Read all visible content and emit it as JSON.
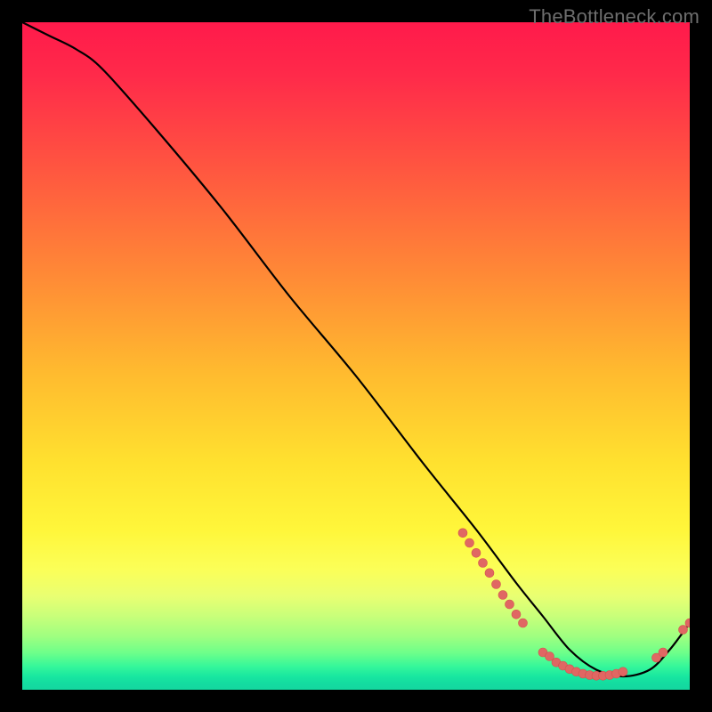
{
  "watermark": "TheBottleneck.com",
  "chart_data": {
    "type": "line",
    "title": "",
    "xlabel": "",
    "ylabel": "",
    "xlim": [
      0,
      100
    ],
    "ylim": [
      0,
      100
    ],
    "series": [
      {
        "name": "curve",
        "x": [
          0,
          4,
          8,
          12,
          20,
          30,
          40,
          50,
          60,
          68,
          74,
          78,
          82,
          86,
          90,
          94,
          97,
          100
        ],
        "y": [
          100,
          98,
          96,
          93,
          84,
          72,
          59,
          47,
          34,
          24,
          16,
          11,
          6,
          3,
          2,
          3,
          6,
          10
        ]
      }
    ],
    "markers": [
      {
        "group": "descent-cluster",
        "points": [
          {
            "x": 66,
            "y": 23.5
          },
          {
            "x": 67,
            "y": 22.0
          },
          {
            "x": 68,
            "y": 20.5
          },
          {
            "x": 69,
            "y": 19.0
          },
          {
            "x": 70,
            "y": 17.5
          },
          {
            "x": 71,
            "y": 15.8
          },
          {
            "x": 72,
            "y": 14.2
          },
          {
            "x": 73,
            "y": 12.8
          },
          {
            "x": 74,
            "y": 11.3
          },
          {
            "x": 75,
            "y": 10.0
          }
        ]
      },
      {
        "group": "valley-cluster",
        "points": [
          {
            "x": 78,
            "y": 5.6
          },
          {
            "x": 79,
            "y": 5.0
          },
          {
            "x": 80,
            "y": 4.1
          },
          {
            "x": 81,
            "y": 3.6
          },
          {
            "x": 82,
            "y": 3.1
          },
          {
            "x": 83,
            "y": 2.7
          },
          {
            "x": 84,
            "y": 2.4
          },
          {
            "x": 85,
            "y": 2.2
          },
          {
            "x": 86,
            "y": 2.1
          },
          {
            "x": 87,
            "y": 2.1
          },
          {
            "x": 88,
            "y": 2.2
          },
          {
            "x": 89,
            "y": 2.4
          },
          {
            "x": 90,
            "y": 2.7
          }
        ]
      },
      {
        "group": "rise-cluster",
        "points": [
          {
            "x": 95,
            "y": 4.8
          },
          {
            "x": 96,
            "y": 5.6
          },
          {
            "x": 99,
            "y": 9.0
          },
          {
            "x": 100,
            "y": 10.0
          }
        ]
      }
    ],
    "colors": {
      "curve": "#000000",
      "marker_fill": "#e06763",
      "marker_stroke": "#d4524e"
    }
  }
}
